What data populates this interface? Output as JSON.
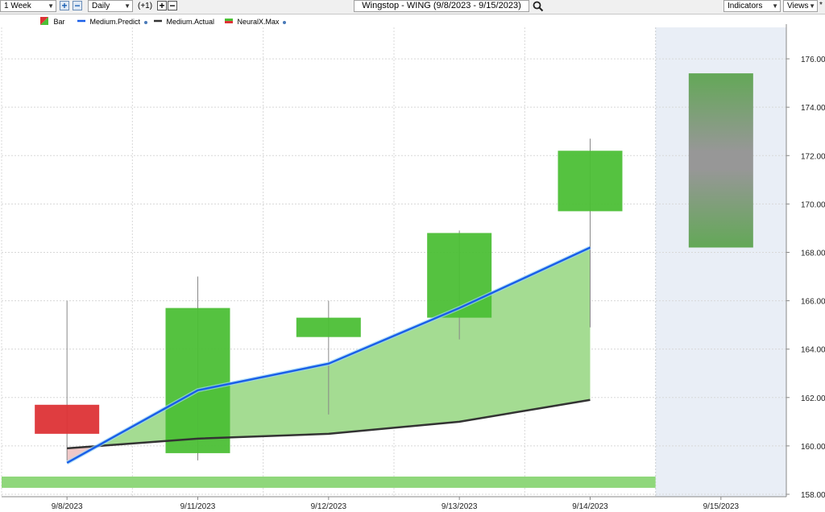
{
  "toolbar": {
    "period": "1 Week",
    "interval": "Daily",
    "offset": "(+1)",
    "title": "Wingstop - WING (9/8/2023 - 9/15/2023)",
    "indicators": "Indicators",
    "views": "Views",
    "star": "*",
    "icons": [
      "plus-icon",
      "minus-icon",
      "plus-icon",
      "minus-icon",
      "search-icon"
    ]
  },
  "legend": {
    "bar": "Bar",
    "medium_predict": "Medium.Predict",
    "medium_actual": "Medium.Actual",
    "neuralx_max": "NeuralX.Max"
  },
  "colors": {
    "up": "#4cbf36",
    "down": "#dd3336",
    "predict": "#1a5fe8",
    "actual": "#333333",
    "band": "#a4dc92",
    "forecast_bg": "#e9eef6"
  },
  "chart_data": {
    "type": "candlestick",
    "ylim": [
      157.9,
      177.3
    ],
    "y_ticks": [
      "158.00",
      "160.00",
      "162.00",
      "164.00",
      "166.00",
      "168.00",
      "170.00",
      "172.00",
      "174.00",
      "176.00"
    ],
    "categories": [
      "9/8/2023",
      "9/11/2023",
      "9/12/2023",
      "9/13/2023",
      "9/14/2023",
      "9/15/2023"
    ],
    "bars": [
      {
        "date": "9/8/2023",
        "open": 161.7,
        "high": 166.0,
        "low": 159.4,
        "close": 160.5
      },
      {
        "date": "9/11/2023",
        "open": 159.7,
        "high": 167.0,
        "low": 159.4,
        "close": 165.7
      },
      {
        "date": "9/12/2023",
        "open": 164.5,
        "high": 166.0,
        "low": 161.3,
        "close": 165.3
      },
      {
        "date": "9/13/2023",
        "open": 165.3,
        "high": 168.9,
        "low": 164.4,
        "close": 168.8
      },
      {
        "date": "9/14/2023",
        "open": 169.7,
        "high": 172.7,
        "low": 164.9,
        "close": 172.2
      }
    ],
    "forecast_bar": {
      "date": "9/15/2023",
      "low": 168.2,
      "high": 175.4
    },
    "series": [
      {
        "name": "Medium.Predict",
        "values": [
          159.3,
          162.3,
          163.4,
          165.7,
          168.2
        ]
      },
      {
        "name": "Medium.Actual",
        "values": [
          159.9,
          160.3,
          160.5,
          161.0,
          161.9
        ]
      }
    ],
    "neuralx_strip_value": 158.5,
    "grid": true
  }
}
